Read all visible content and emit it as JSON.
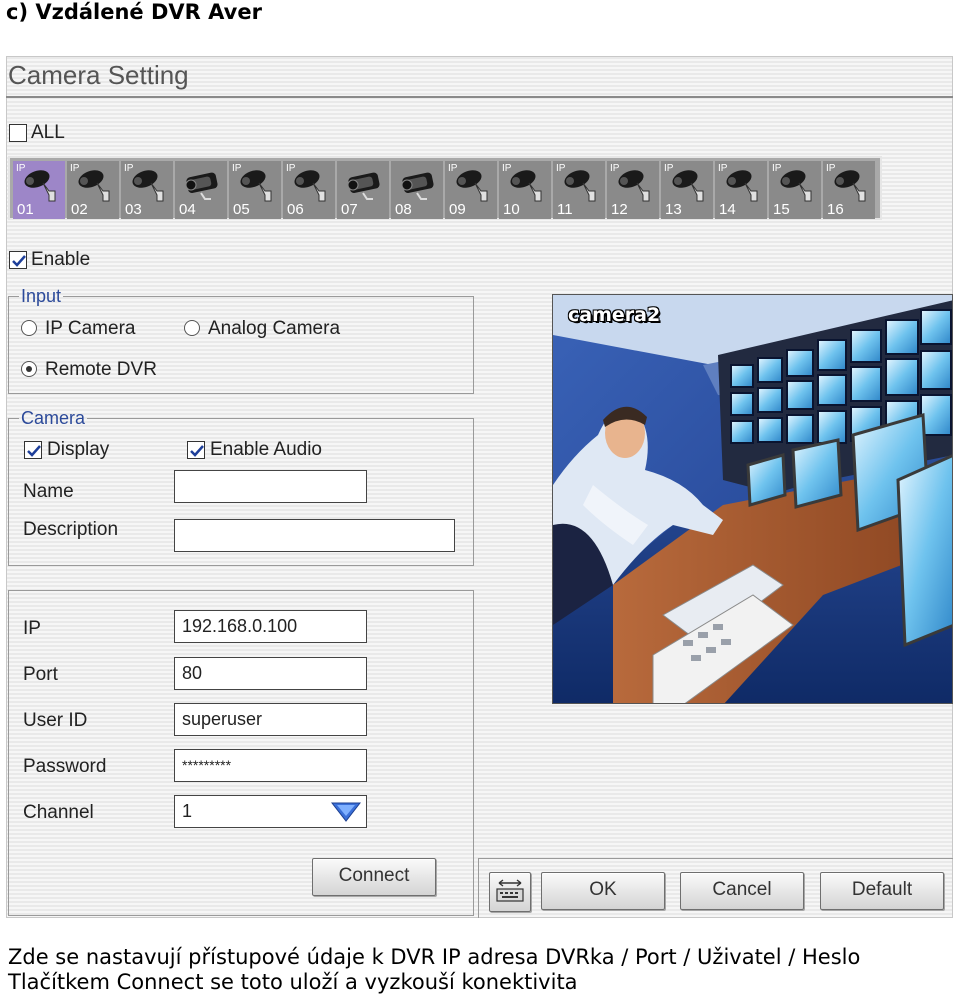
{
  "heading": "c) Vzdálené DVR Aver",
  "window": {
    "title": "Camera Setting"
  },
  "all_checkbox": {
    "label": "ALL",
    "checked": false
  },
  "camera_tiles": [
    {
      "number": "01",
      "badge": "IP",
      "type": "ip",
      "selected": true
    },
    {
      "number": "02",
      "badge": "IP",
      "type": "ip",
      "selected": false
    },
    {
      "number": "03",
      "badge": "IP",
      "type": "ip",
      "selected": false
    },
    {
      "number": "04",
      "badge": "",
      "type": "analog",
      "selected": false
    },
    {
      "number": "05",
      "badge": "IP",
      "type": "ip",
      "selected": false
    },
    {
      "number": "06",
      "badge": "IP",
      "type": "ip",
      "selected": false
    },
    {
      "number": "07",
      "badge": "",
      "type": "analog",
      "selected": false
    },
    {
      "number": "08",
      "badge": "",
      "type": "analog",
      "selected": false
    },
    {
      "number": "09",
      "badge": "IP",
      "type": "ip",
      "selected": false
    },
    {
      "number": "10",
      "badge": "IP",
      "type": "ip",
      "selected": false
    },
    {
      "number": "11",
      "badge": "IP",
      "type": "ip",
      "selected": false
    },
    {
      "number": "12",
      "badge": "IP",
      "type": "ip",
      "selected": false
    },
    {
      "number": "13",
      "badge": "IP",
      "type": "ip",
      "selected": false
    },
    {
      "number": "14",
      "badge": "IP",
      "type": "ip",
      "selected": false
    },
    {
      "number": "15",
      "badge": "IP",
      "type": "ip",
      "selected": false
    },
    {
      "number": "16",
      "badge": "IP",
      "type": "ip",
      "selected": false
    }
  ],
  "enable_checkbox": {
    "label": "Enable",
    "checked": true
  },
  "input_group": {
    "legend": "Input",
    "options": {
      "ip_camera": "IP Camera",
      "analog_camera": "Analog Camera",
      "remote_dvr": "Remote DVR"
    },
    "selected": "remote_dvr"
  },
  "camera_group": {
    "legend": "Camera",
    "display": {
      "label": "Display",
      "checked": true
    },
    "enable_audio": {
      "label": "Enable Audio",
      "checked": true
    },
    "name_label": "Name",
    "name_value": "",
    "description_label": "Description",
    "description_value": ""
  },
  "connection": {
    "ip_label": "IP",
    "ip_value": "192.168.0.100",
    "port_label": "Port",
    "port_value": "80",
    "userid_label": "User ID",
    "userid_value": "superuser",
    "password_label": "Password",
    "password_value": "*********",
    "channel_label": "Channel",
    "channel_value": "1",
    "connect_button": "Connect"
  },
  "preview": {
    "label": "camera2"
  },
  "footer_buttons": {
    "ok": "OK",
    "cancel": "Cancel",
    "default": "Default",
    "keyboard_icon": "keyboard-icon"
  },
  "caption": {
    "line1": "Zde se nastavují přístupové údaje k DVR IP adresa DVRka / Port / Uživatel / Heslo",
    "line2": "Tlačítkem Connect se toto uloží a vyzkouší konektivita"
  },
  "colors": {
    "selected_tile": "#9d86c8",
    "tile": "#8a8a8a",
    "legend": "#2c4a9a",
    "dropdown_arrow": "#3a6fd8"
  }
}
